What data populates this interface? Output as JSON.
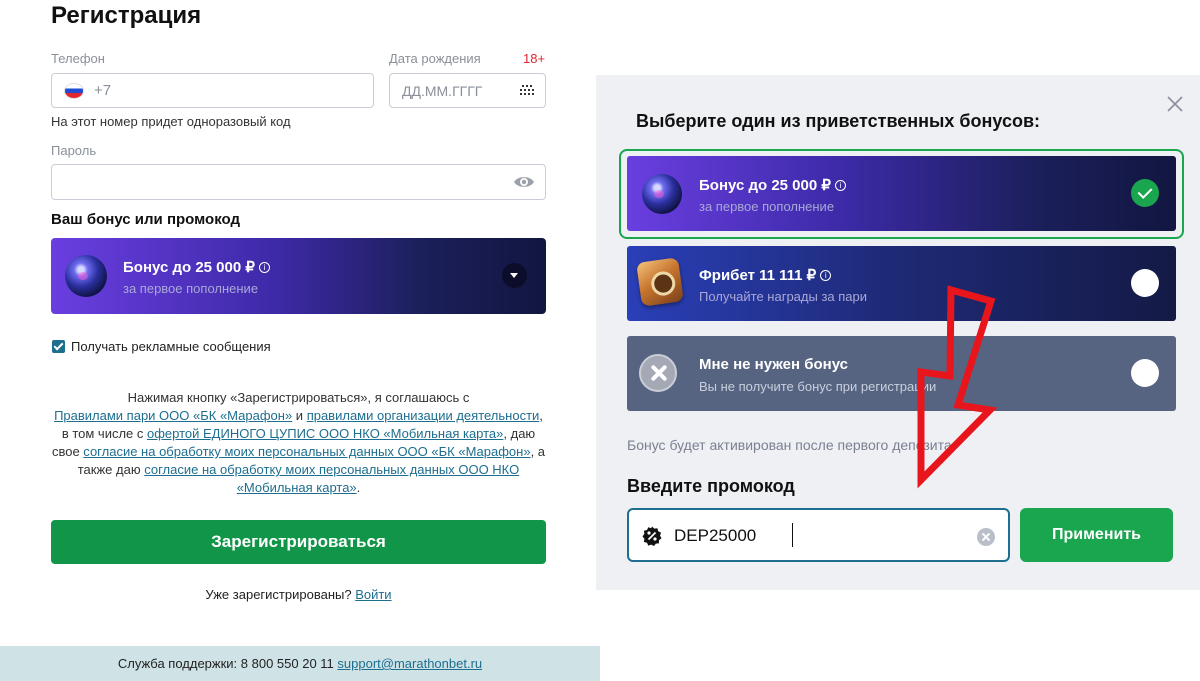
{
  "registration": {
    "title": "Регистрация",
    "phone_label": "Телефон",
    "phone_prefix": "+7",
    "birth_label": "Дата рождения",
    "age_limit": "18+",
    "birth_placeholder": "ДД.ММ.ГГГГ",
    "phone_hint": "На этот номер придет одноразовый код",
    "password_label": "Пароль",
    "bonus_heading": "Ваш бонус или промокод",
    "selected_bonus": {
      "title": "Бонус до 25 000 ₽",
      "subtitle": "за первое пополнение"
    },
    "ads_checkbox": {
      "label": "Получать рекламные сообщения",
      "checked": true
    },
    "agreement": {
      "t1": "Нажимая кнопку «Зарегистрироваться», я соглашаюсь с",
      "l1": "Правилами пари ООО «БК «Марафон»",
      "t2": " и ",
      "l2": "правилами организации деятельности",
      "t3": ", в том числе с ",
      "l3": "офертой ЕДИНОГО ЦУПИС ООО НКО «Мобильная карта»",
      "t4": ", даю свое ",
      "l4": "согласие на обработку моих персональных данных ООО «БК «Марафон»",
      "t5": ", а также даю ",
      "l5": "согласие на обработку моих персональных данных ООО НКО «Мобильная карта»",
      "t6": "."
    },
    "register_button": "Зарегистрироваться",
    "already_text": "Уже зарегистрированы? ",
    "login_link": "Войти",
    "support_text": "Служба поддержки: 8 800 550 20 11 ",
    "support_email": "support@marathonbet.ru"
  },
  "modal": {
    "title": "Выберите один из приветственных бонусов:",
    "options": [
      {
        "title": "Бонус до 25 000 ₽",
        "subtitle": "за первое пополнение",
        "selected": true,
        "has_info": true
      },
      {
        "title": "Фрибет 11 111 ₽",
        "subtitle": "Получайте награды за пари",
        "selected": false,
        "has_info": true
      },
      {
        "title": "Мне не нужен бонус",
        "subtitle": "Вы не получите бонус при регистрации",
        "selected": false,
        "has_info": false
      }
    ],
    "activation_note": "Бонус будет активирован после первого депозита.",
    "promo_heading": "Введите промокод",
    "promo_value": "DEP25000",
    "apply_button": "Применить"
  },
  "colors": {
    "accent_green": "#119649",
    "link_teal": "#1d6e8f",
    "annotation_red": "#e8161c",
    "modal_bg": "#eef0f4"
  },
  "icons": [
    "russia-flag-icon",
    "calendar-icon",
    "eye-icon",
    "info-icon",
    "chevron-down-icon",
    "checkbox-checked-icon",
    "close-icon",
    "check-icon",
    "promo-badge-icon",
    "clear-icon",
    "red-arrow-annotation"
  ]
}
